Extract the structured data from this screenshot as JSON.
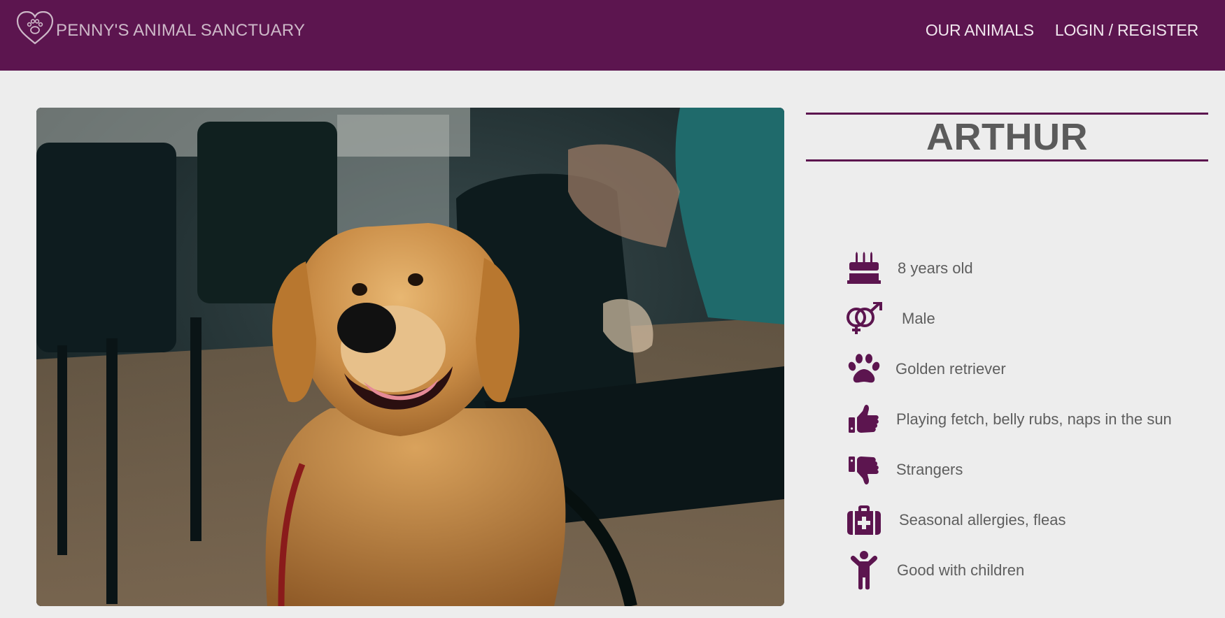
{
  "header": {
    "brand_name": "PENNY'S ANIMAL SANCTUARY",
    "logo_icon": "heart-paw-icon",
    "nav": [
      {
        "label": "OUR ANIMALS"
      },
      {
        "label": "LOGIN / REGISTER"
      }
    ],
    "bar_color": "#5c154f"
  },
  "animal": {
    "name": "ARTHUR",
    "photo_description": "golden-retriever-photo",
    "facts": [
      {
        "icon": "birthday-cake-icon",
        "text": "8 years old"
      },
      {
        "icon": "gender-symbols-icon",
        "text": "Male"
      },
      {
        "icon": "paw-icon",
        "text": "Golden retriever"
      },
      {
        "icon": "thumbs-up-icon",
        "text": "Playing fetch, belly rubs, naps in the sun"
      },
      {
        "icon": "thumbs-down-icon",
        "text": "Strangers"
      },
      {
        "icon": "medical-kit-icon",
        "text": "Seasonal allergies, fleas"
      },
      {
        "icon": "child-icon",
        "text": "Good with children"
      }
    ]
  },
  "colors": {
    "accent": "#5c154f",
    "background": "#ededed",
    "text": "#5a5a5a"
  }
}
